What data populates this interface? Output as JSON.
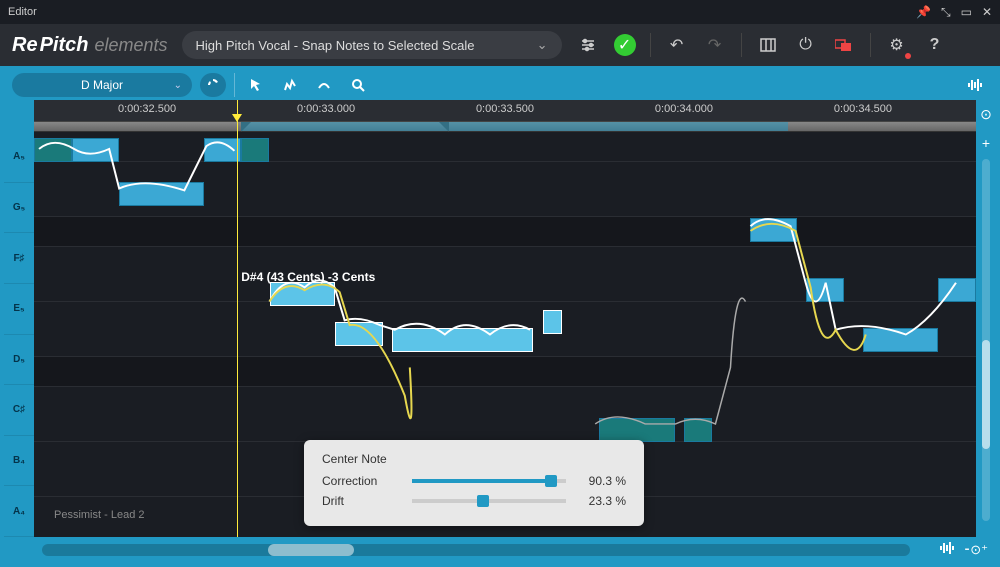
{
  "window": {
    "title": "Editor"
  },
  "app": {
    "logo_re": "Re",
    "logo_pitch": "Pitch",
    "logo_elements": "elements"
  },
  "preset": {
    "name": "High Pitch Vocal - Snap Notes to Selected Scale"
  },
  "scale": {
    "name": "D Major"
  },
  "timeline": {
    "ticks": [
      "0:00:32.500",
      "0:00:33.000",
      "0:00:33.500",
      "0:00:34.000",
      "0:00:34.500"
    ]
  },
  "note_labels": [
    "A₅",
    "G₅",
    "F♯",
    "E₅",
    "D₅",
    "C♯",
    "B₄",
    "A₄"
  ],
  "tooltip": {
    "text": "D#4 (43 Cents) -3 Cents"
  },
  "clip": {
    "name": "Pessimist - Lead 2"
  },
  "center_note": {
    "title": "Center Note",
    "correction_label": "Correction",
    "correction_value": "90.3 %",
    "correction_pct": 90.3,
    "drift_label": "Drift",
    "drift_value": "23.3 %",
    "drift_pct": 23.3
  },
  "colors": {
    "accent": "#2199c4",
    "selected": "#5cc4e8",
    "teal": "#1a7a7a",
    "playhead": "#ffeb3b"
  }
}
